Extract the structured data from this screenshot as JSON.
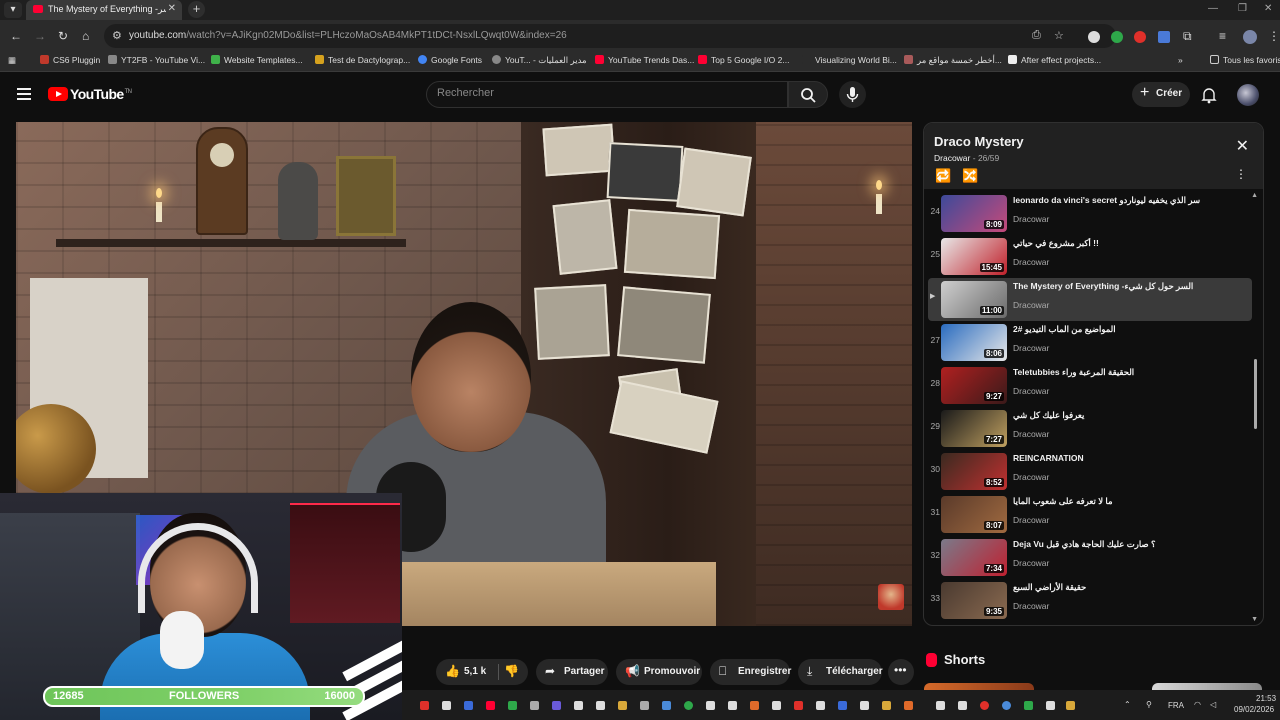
{
  "browser": {
    "tab_title": "The Mystery of Everything -السر",
    "url_main": "youtube.com",
    "url_rest": "/watch?v=AJiKgn02MDo&list=PLHczoMaOsAB4MkPT1tDCt-NsxlLQwqt0W&index=26",
    "bookmarks": [
      {
        "label": "CS6 Pluggin",
        "color": "#c0392b"
      },
      {
        "label": "YT2FB - YouTube Vi...",
        "color": "#888888"
      },
      {
        "label": "Website Templates...",
        "color": "#3fb24a"
      },
      {
        "label": "Test de Dactylograp...",
        "color": "#d6a21e"
      },
      {
        "label": "Google Fonts",
        "color": "#4285f4"
      },
      {
        "label": "YouT... - مدير العمليات",
        "color": "#888888"
      },
      {
        "label": "YouTube Trends Das...",
        "color": "#ff0033"
      },
      {
        "label": "Top 5 Google I/O 2...",
        "color": "#ff0033"
      },
      {
        "label": "Visualizing World Bi...",
        "color": "#2b2b2b"
      },
      {
        "label": "أخطر خمسة مواقع مر...",
        "color": "#a85a5a"
      },
      {
        "label": "After effect projects...",
        "color": "#eeeeee"
      }
    ],
    "all_favorites": "Tous les favoris"
  },
  "masthead": {
    "logo_text": "YouTube",
    "logo_suffix": "TN",
    "search_placeholder": "Rechercher",
    "create_label": "Créer"
  },
  "actions": {
    "likes": "5,1 k",
    "share": "Partager",
    "promote": "Promouvoir",
    "save": "Enregistrer",
    "download": "Télécharger"
  },
  "overlay": {
    "followers_current": "12685",
    "followers_label": "FOLLOWERS",
    "followers_goal": "16000"
  },
  "playlist": {
    "title": "Draco Mystery",
    "channel": "Dracowar",
    "position": "26/59",
    "items": [
      {
        "index": "24",
        "title": "leonardo da vinci's secret سر الذي يخفيه ليوناردو",
        "channel": "Dracowar",
        "duration": "8:09",
        "c1": "#3d4a9a",
        "c2": "#c64a7a",
        "active": false
      },
      {
        "index": "25",
        "title": "أكبر مشروع في حياتي !!",
        "channel": "Dracowar",
        "duration": "15:45",
        "c1": "#e8e8e8",
        "c2": "#c0202a",
        "active": false
      },
      {
        "index": "26",
        "title": "The Mystery of Everything -السر حول كل شيء",
        "channel": "Dracowar",
        "duration": "11:00",
        "c1": "#cfcfcf",
        "c2": "#6a6a6a",
        "active": true
      },
      {
        "index": "27",
        "title": "المواضيع من الماب التيديو #2",
        "channel": "Dracowar",
        "duration": "8:06",
        "c1": "#2a6cc0",
        "c2": "#e8e8e8",
        "active": false
      },
      {
        "index": "28",
        "title": "Teletubbies الحقيقة المرعبة وراء",
        "channel": "Dracowar",
        "duration": "9:27",
        "c1": "#b02020",
        "c2": "#3a1a1a",
        "active": false
      },
      {
        "index": "29",
        "title": "يعرفوا عليك كل شي",
        "channel": "Dracowar",
        "duration": "7:27",
        "c1": "#1a1a1a",
        "c2": "#c0a060",
        "active": false
      },
      {
        "index": "30",
        "title": "REINCARNATION",
        "channel": "Dracowar",
        "duration": "8:52",
        "c1": "#3a2a20",
        "c2": "#c03030",
        "active": false
      },
      {
        "index": "31",
        "title": "ما لا تعرفه على شعوب المايا",
        "channel": "Dracowar",
        "duration": "8:07",
        "c1": "#5a3a2a",
        "c2": "#a06a40",
        "active": false
      },
      {
        "index": "32",
        "title": "Deja Vu ؟ صارت عليك الحاجة هادي قبل",
        "channel": "Dracowar",
        "duration": "7:34",
        "c1": "#7a7a8a",
        "c2": "#c02030",
        "active": false
      },
      {
        "index": "33",
        "title": "حقيقة الأراضي السبع",
        "channel": "Dracowar",
        "duration": "9:35",
        "c1": "#4a3a30",
        "c2": "#8a6a50",
        "active": false
      }
    ]
  },
  "shorts": {
    "label": "Shorts"
  },
  "taskbar": {
    "lang": "FRA",
    "time": "21:53",
    "date": "09/02/2026"
  }
}
